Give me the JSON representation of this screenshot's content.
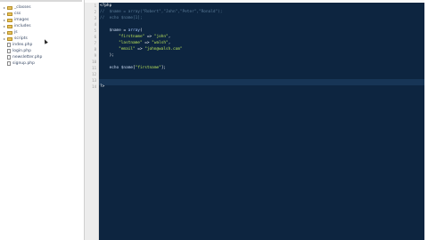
{
  "file_tree": {
    "items": [
      {
        "type": "folder",
        "label": "_classes",
        "expanded": false
      },
      {
        "type": "folder",
        "label": "css",
        "expanded": false
      },
      {
        "type": "folder",
        "label": "images",
        "expanded": false
      },
      {
        "type": "folder",
        "label": "includes",
        "expanded": false
      },
      {
        "type": "folder",
        "label": "js",
        "expanded": false
      },
      {
        "type": "folder",
        "label": "scripts",
        "expanded": false
      },
      {
        "type": "file",
        "label": "index.php"
      },
      {
        "type": "file",
        "label": "login.php"
      },
      {
        "type": "file",
        "label": "newsletter.php"
      },
      {
        "type": "file",
        "label": "signup.php"
      }
    ]
  },
  "editor": {
    "line_numbers": [
      "1",
      "2",
      "3",
      "4",
      "5",
      "6",
      "7",
      "8",
      "9",
      "10",
      "11",
      "12",
      "13",
      "14"
    ],
    "lines": [
      [
        {
          "c": "tag",
          "t": "<?php"
        }
      ],
      [
        {
          "c": "comment",
          "t": "//  $name = array(\"Robert\",\"John\",\"Peter\",\"Ronald\");"
        }
      ],
      [
        {
          "c": "comment",
          "t": "//  echo $name[1];"
        }
      ],
      [],
      [
        {
          "c": "var",
          "t": "    $name"
        },
        {
          "c": "op",
          "t": " = "
        },
        {
          "c": "kw",
          "t": "array"
        },
        {
          "c": "op",
          "t": "("
        }
      ],
      [
        {
          "c": "str",
          "t": "        \"firstname\""
        },
        {
          "c": "op",
          "t": " => "
        },
        {
          "c": "str",
          "t": "\"john\""
        },
        {
          "c": "op",
          "t": ","
        }
      ],
      [
        {
          "c": "str",
          "t": "        \"lastname\""
        },
        {
          "c": "op",
          "t": " => "
        },
        {
          "c": "str",
          "t": "\"walsh\""
        },
        {
          "c": "op",
          "t": ","
        }
      ],
      [
        {
          "c": "str",
          "t": "        \"email\""
        },
        {
          "c": "op",
          "t": " => "
        },
        {
          "c": "str",
          "t": "\"john@walsh.com\""
        }
      ],
      [
        {
          "c": "op",
          "t": "    );"
        }
      ],
      [],
      [
        {
          "c": "var",
          "t": "    echo $name"
        },
        {
          "c": "op",
          "t": "["
        },
        {
          "c": "str",
          "t": "\"firstname\""
        },
        {
          "c": "op",
          "t": "];"
        }
      ],
      [],
      [],
      [
        {
          "c": "tag",
          "t": "?>"
        }
      ]
    ],
    "active_line": 13
  }
}
